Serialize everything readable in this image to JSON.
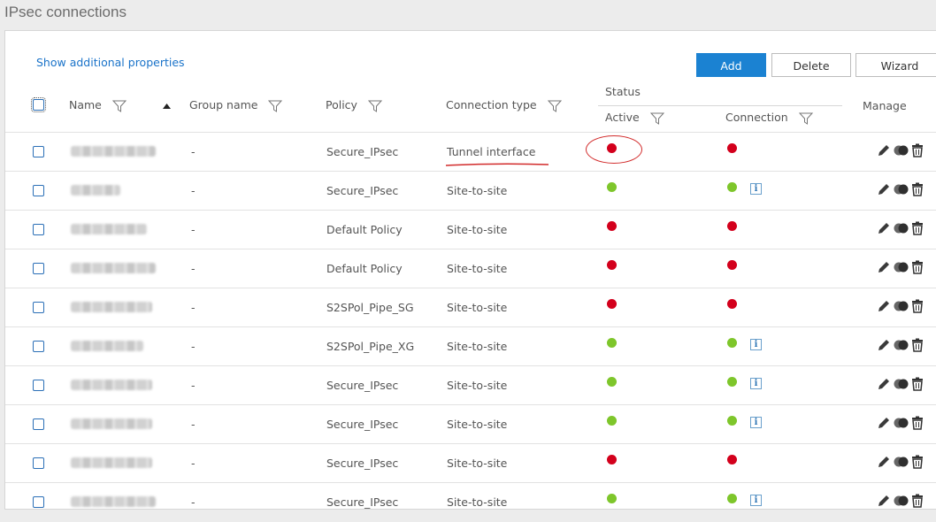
{
  "page": {
    "title": "IPsec connections"
  },
  "toolbar": {
    "show_additional": "Show additional properties",
    "add": "Add",
    "delete": "Delete",
    "wizard": "Wizard"
  },
  "columns": {
    "name": "Name",
    "group_name": "Group name",
    "policy": "Policy",
    "connection_type": "Connection type",
    "status": "Status",
    "active": "Active",
    "connection": "Connection",
    "manage": "Manage"
  },
  "colors": {
    "accent": "#1b82d2",
    "status_active": "#7ec62b",
    "status_inactive": "#d3001c",
    "annotation": "#d22b2b"
  },
  "rows": [
    {
      "name": "",
      "group": "-",
      "policy": "Secure_IPsec",
      "type": "Tunnel interface",
      "active": "red",
      "connection": "red",
      "info": false
    },
    {
      "name": "",
      "group": "-",
      "policy": "Secure_IPsec",
      "type": "Site-to-site",
      "active": "green",
      "connection": "green",
      "info": true
    },
    {
      "name": "",
      "group": "-",
      "policy": "Default Policy",
      "type": "Site-to-site",
      "active": "red",
      "connection": "red",
      "info": false
    },
    {
      "name": "",
      "group": "-",
      "policy": "Default Policy",
      "type": "Site-to-site",
      "active": "red",
      "connection": "red",
      "info": false
    },
    {
      "name": "",
      "group": "-",
      "policy": "S2SPol_Pipe_SG",
      "type": "Site-to-site",
      "active": "red",
      "connection": "red",
      "info": false
    },
    {
      "name": "",
      "group": "-",
      "policy": "S2SPol_Pipe_XG",
      "type": "Site-to-site",
      "active": "green",
      "connection": "green",
      "info": true
    },
    {
      "name": "",
      "group": "-",
      "policy": "Secure_IPsec",
      "type": "Site-to-site",
      "active": "green",
      "connection": "green",
      "info": true
    },
    {
      "name": "",
      "group": "-",
      "policy": "Secure_IPsec",
      "type": "Site-to-site",
      "active": "green",
      "connection": "green",
      "info": true
    },
    {
      "name": "",
      "group": "-",
      "policy": "Secure_IPsec",
      "type": "Site-to-site",
      "active": "red",
      "connection": "red",
      "info": false
    },
    {
      "name": "",
      "group": "-",
      "policy": "Secure_IPsec",
      "type": "Site-to-site",
      "active": "green",
      "connection": "green",
      "info": true
    }
  ]
}
